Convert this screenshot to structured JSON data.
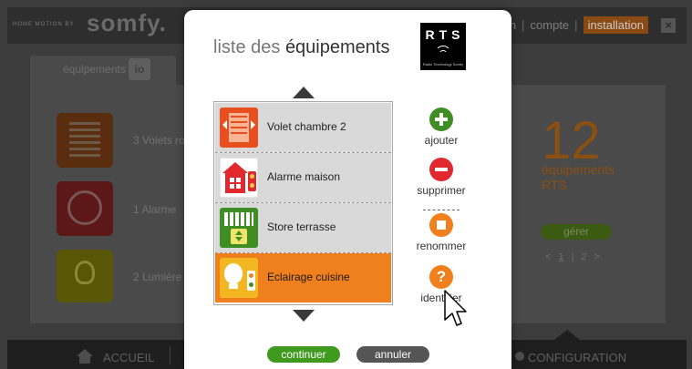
{
  "background": {
    "brand_tagline": "HOME MOTION BY",
    "brand_name": "somfy.",
    "topnav": {
      "item_partial": "on",
      "sep1": "|",
      "compte": "compte",
      "sep2": "|",
      "installation": "installation"
    },
    "close_glyph": "×",
    "tab_label": "équipements",
    "tab_badge": "io",
    "devices": [
      {
        "label": "3 Volets ro"
      },
      {
        "label": "1 Alarme"
      },
      {
        "label": "2 Lumière"
      }
    ],
    "rts_count": "12",
    "rts_label_line1": "équipements",
    "rts_label_line2": "RTS",
    "gerer": "gérer",
    "pager": {
      "prev": "<",
      "page1": "1",
      "sep": "|",
      "page2": "2",
      "next": ">"
    },
    "footer": {
      "accueil": "ACCUEIL",
      "configuration": "CONFIGURATION"
    }
  },
  "modal": {
    "title_light": "liste des",
    "title_strong": "équipements",
    "rts_logo": {
      "text": "RTS",
      "subtext": "Radio Technology Somfy"
    },
    "items": [
      {
        "label": "Volet chambre 2",
        "icon": "shutter-icon",
        "selected": false
      },
      {
        "label": "Alarme maison",
        "icon": "alarm-icon",
        "selected": false
      },
      {
        "label": "Store terrasse",
        "icon": "awning-icon",
        "selected": false
      },
      {
        "label": "Eclairage cuisine",
        "icon": "lamp-icon",
        "selected": true
      }
    ],
    "actions": {
      "ajouter": "ajouter",
      "supprimer": "supprimer",
      "renommer": "renommer",
      "identifier": "identifier",
      "identifier_glyph": "?"
    },
    "buttons": {
      "continuer": "continuer",
      "annuler": "annuler"
    }
  },
  "colors": {
    "accent_orange": "#f07f1e",
    "add_green": "#3f8e24",
    "delete_red": "#e0282e",
    "continue_green": "#3f9a1e",
    "cancel_gray": "#555555"
  }
}
